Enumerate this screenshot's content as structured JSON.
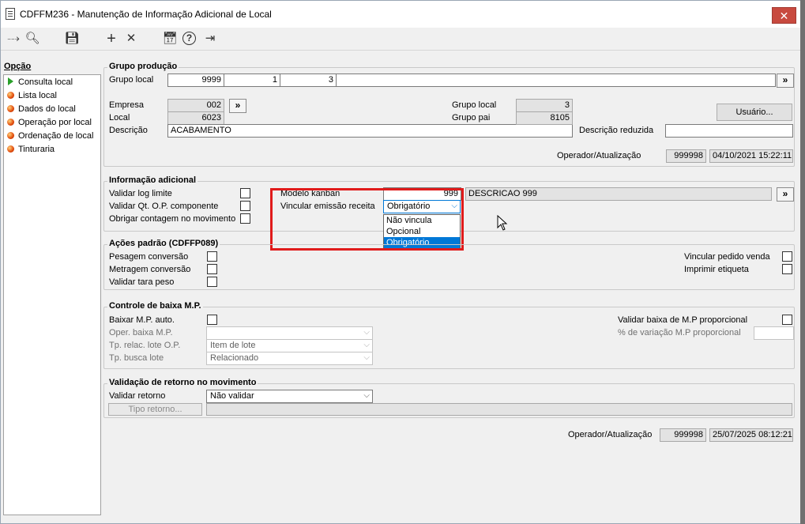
{
  "window": {
    "title": "CDFFM236 - Manutenção de Informação Adicional de Local",
    "close_glyph": "✕"
  },
  "toolbar": [
    {
      "name": "exit-to-icon",
      "glyph": "⤏"
    },
    {
      "name": "search-icon",
      "glyph": "🔍︎"
    },
    {
      "name": "save-icon",
      "glyph": "💾︎"
    },
    {
      "name": "add-icon",
      "glyph": "+"
    },
    {
      "name": "delete-icon",
      "glyph": "✕"
    },
    {
      "name": "calendar-icon",
      "glyph": "📅︎"
    },
    {
      "name": "help-icon",
      "glyph": "?"
    },
    {
      "name": "logout-icon",
      "glyph": "⇥"
    }
  ],
  "sidebar": {
    "title": "Opção",
    "items": [
      {
        "label": "Consulta local",
        "active": true
      },
      {
        "label": "Lista local"
      },
      {
        "label": "Dados do local"
      },
      {
        "label": "Operação por local"
      },
      {
        "label": "Ordenação de local"
      },
      {
        "label": "Tinturaria"
      }
    ]
  },
  "grupo_producao": {
    "title": "Grupo produção",
    "grupo_local_label": "Grupo local",
    "grupo_local_values": [
      "9999",
      "1",
      "3"
    ],
    "next_glyph": "»",
    "empresa_label": "Empresa",
    "empresa_value": "002",
    "local_label": "Local",
    "local_value": "6023",
    "descricao_label": "Descrição",
    "descricao_value": "ACABAMENTO",
    "grupo_local_right_label": "Grupo local",
    "grupo_local_right_value": "3",
    "grupo_pai_label": "Grupo pai",
    "grupo_pai_value": "8105",
    "usuario_button": "Usuário...",
    "descricao_reduzida_label": "Descrição reduzida",
    "descricao_reduzida_value": "",
    "operador_label": "Operador/Atualização",
    "operador_value": "999998",
    "atualizacao_value": "04/10/2021 15:22:11"
  },
  "info_adicional": {
    "title": "Informação adicional",
    "validar_log_limite": "Validar log limite",
    "validar_qt_op": "Validar Qt. O.P. componente",
    "obrigar_contagem": "Obrigar contagem no movimento",
    "modelo_kanban_label": "Modelo kanban",
    "modelo_kanban_value": "999",
    "modelo_kanban_desc": "DESCRICAO 999",
    "vincular_label": "Vincular emissão receita",
    "vincular_value": "Obrigatório",
    "vincular_options": [
      "Não vincula",
      "Opcional",
      "Obrigatório"
    ]
  },
  "acoes_padrao": {
    "title": "Ações padrão (CDFFP089)",
    "pesagem": "Pesagem conversão",
    "metragem": "Metragem conversão",
    "validar_tara": "Validar tara peso",
    "vincular_pedido": "Vincular pedido venda",
    "imprimir_etiqueta": "Imprimir etiqueta"
  },
  "controle_baixa": {
    "title": "Controle de baixa M.P.",
    "baixar_auto": "Baixar M.P. auto.",
    "oper_baixa": "Oper. baixa M.P.",
    "oper_baixa_value": "",
    "tp_relac": "Tp. relac. lote O.P.",
    "tp_relac_value": "Item de lote",
    "tp_busca": "Tp. busca lote",
    "tp_busca_value": "Relacionado",
    "validar_proporcional": "Validar baixa de M.P proporcional",
    "perc_variacao": "% de variação M.P proporcional",
    "perc_variacao_value": ""
  },
  "validacao_retorno": {
    "title": "Validação de retorno no movimento",
    "validar_retorno_label": "Validar retorno",
    "validar_retorno_value": "Não validar",
    "tipo_retorno_button": "Tipo retorno...",
    "tipo_retorno_value": ""
  },
  "footer": {
    "operador_label": "Operador/Atualização",
    "operador_value": "999998",
    "atualizacao_value": "25/07/2025 08:12:21"
  },
  "colors": {
    "accent": "#0078d7",
    "highlight_box": "#e01b1b",
    "close_button": "#c84a3f"
  }
}
